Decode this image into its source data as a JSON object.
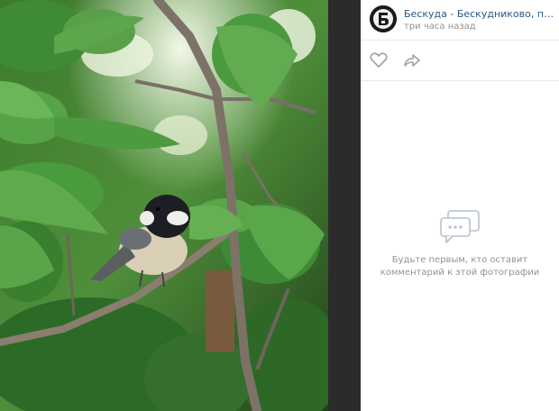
{
  "post": {
    "author": "Бескуда - Бескудниково, прививай...",
    "time": "три часа назад"
  },
  "actions": {
    "like_icon": "heart-icon",
    "share_icon": "share-arrow-icon"
  },
  "comments": {
    "empty_text": "Будьте первым, кто оставит комментарий к этой фотографии",
    "icon": "speech-bubble-icon"
  },
  "photo": {
    "subject": "bird on branch"
  }
}
